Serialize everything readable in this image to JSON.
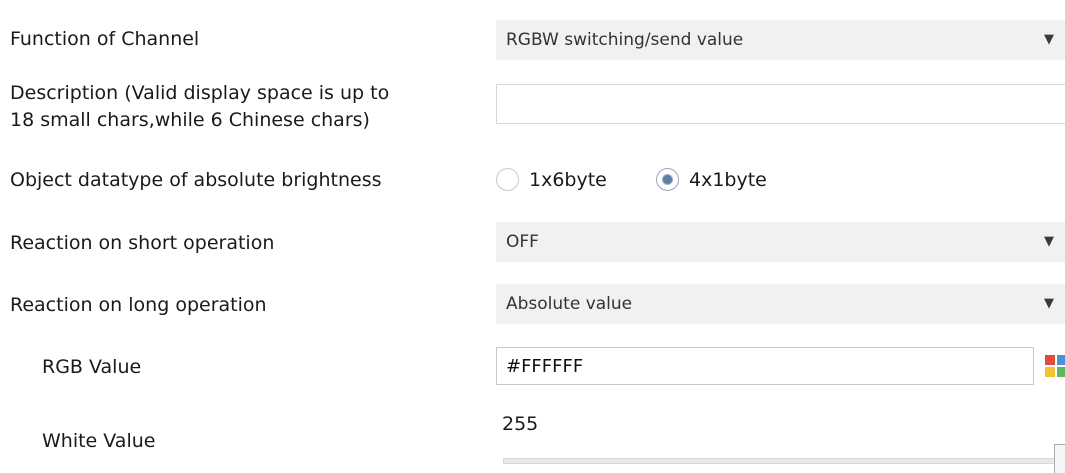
{
  "rows": {
    "function_of_channel": {
      "label": "Function of Channel",
      "value": "RGBW switching/send value"
    },
    "description": {
      "label_line1": "Description (Valid display space is up to",
      "label_line2": "18 small chars,while 6 Chinese chars)",
      "value": ""
    },
    "object_datatype": {
      "label": "Object datatype of absolute brightness",
      "options": [
        "1x6byte",
        "4x1byte"
      ],
      "selected": "4x1byte"
    },
    "reaction_short": {
      "label": "Reaction on short operation",
      "value": "OFF"
    },
    "reaction_long": {
      "label": "Reaction on long operation",
      "value": "Absolute value"
    },
    "rgb_value": {
      "label": "RGB Value",
      "value": "#FFFFFF"
    },
    "white_value": {
      "label": "White Value",
      "value": "255",
      "slider_fraction": 1.0
    }
  },
  "icons": {
    "dropdown_arrow": "chevron-down-icon",
    "color_picker": "color-palette-icon"
  },
  "colors": {
    "select_background": "#f1f1f1",
    "radio_selected": "#5b7fa6",
    "palette": [
      "#e24b3b",
      "#4a90d9",
      "#f2c230",
      "#5bb85b"
    ]
  }
}
